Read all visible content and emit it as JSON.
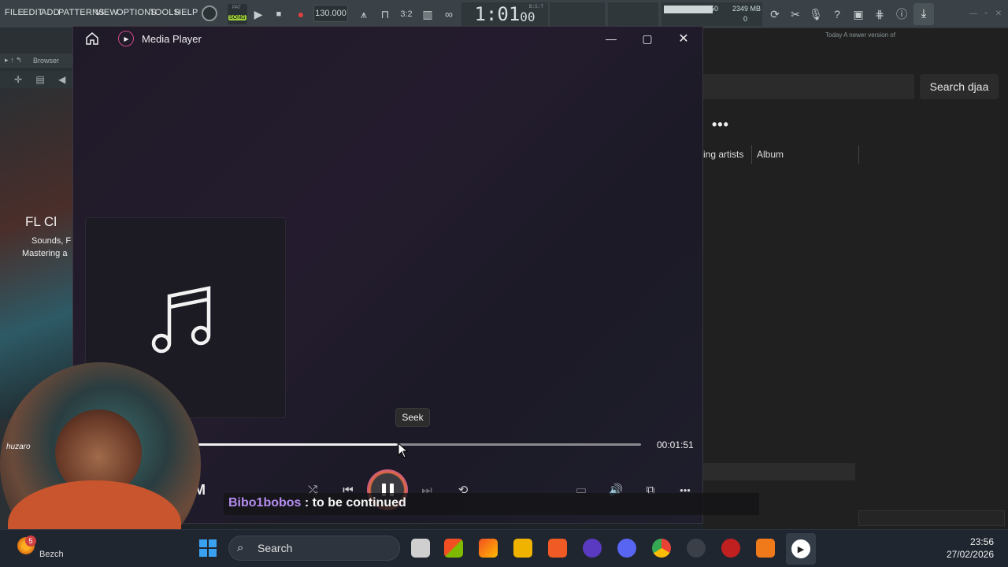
{
  "fl": {
    "menu": [
      "FILE",
      "EDIT",
      "ADD",
      "PATTERNS",
      "VIEW",
      "OPTIONS",
      "TOOLS",
      "HELP"
    ],
    "mode": "SONG",
    "pat": "PAT",
    "tempo": "130.000",
    "time_main": "1:01",
    "time_sub": "00",
    "bst": "B:S:T",
    "mem": "2349 MB",
    "mem_val": "0",
    "cpu": "50",
    "hint": "Today  A newer version of",
    "browser_label": "Browser",
    "promo_title": "FL Cl",
    "promo_line1": "Sounds, F",
    "promo_line2": "Mastering a"
  },
  "bg_app": {
    "search": "Search djaa",
    "more": "•••",
    "col_artists": "ing artists",
    "col_album": "Album"
  },
  "player": {
    "title": "Media Player",
    "tooltip": "Seek",
    "duration": "00:01:51",
    "progress": 0.46,
    "watermark": "M"
  },
  "chat": {
    "user": "Bibo1bobos",
    "sep": " : ",
    "message": "to be continued"
  },
  "cam": {
    "label": "huzaro"
  },
  "taskbar": {
    "search": "Search",
    "weather_badge": "5",
    "weather_label": "Bezch",
    "time": "23:56",
    "date": "27/02/2026"
  }
}
